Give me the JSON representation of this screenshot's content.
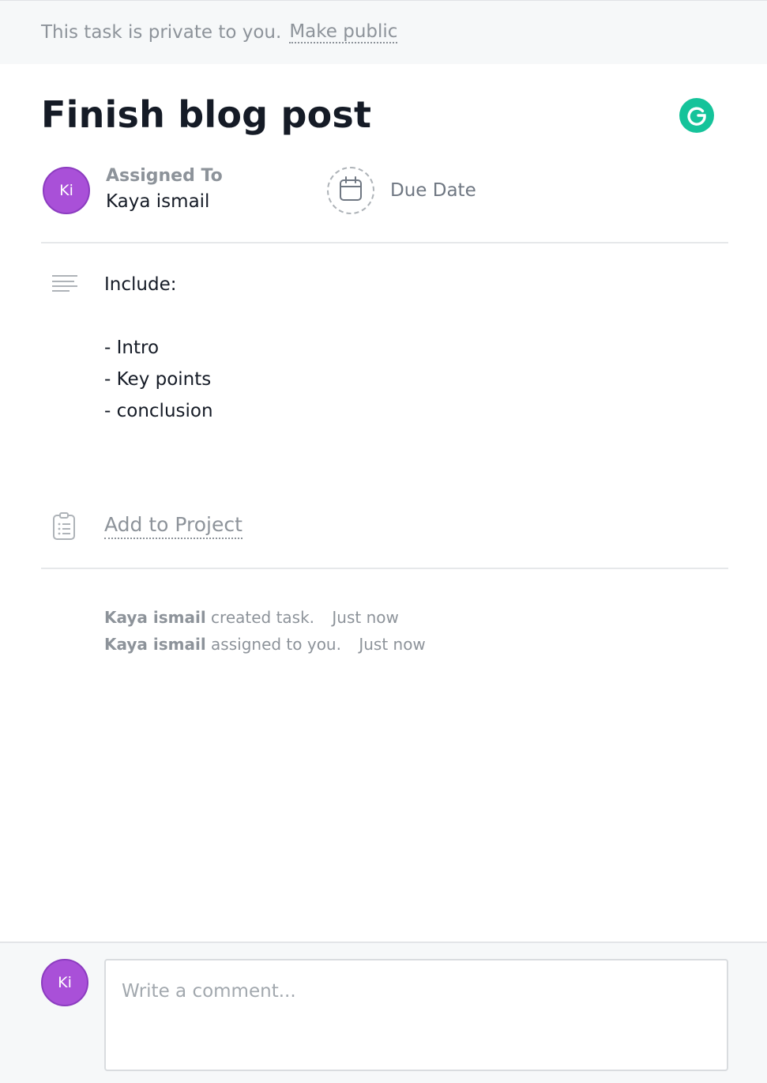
{
  "privacy_bar": {
    "message": "This task is private to you.",
    "make_public_label": "Make public"
  },
  "task": {
    "title": "Finish blog post",
    "assignee": {
      "label": "Assigned To",
      "initials": "Ki",
      "name": "Kaya ismail"
    },
    "due_date_label": "Due Date",
    "description": {
      "lines": [
        "Include:",
        "",
        "- Intro",
        "- Key points",
        "- conclusion"
      ]
    },
    "add_to_project_label": "Add to Project"
  },
  "activity": [
    {
      "actor": "Kaya ismail",
      "action": "created task.",
      "time": "Just now"
    },
    {
      "actor": "Kaya ismail",
      "action": "assigned to you.",
      "time": "Just now"
    }
  ],
  "comment": {
    "avatar_initials": "Ki",
    "placeholder": "Write a comment..."
  },
  "colors": {
    "avatar": "#a950d8",
    "grammarly": "#15c39a",
    "muted_text": "#8d939a"
  },
  "icons": [
    "grammarly-icon",
    "calendar-icon",
    "description-icon",
    "clipboard-icon"
  ]
}
